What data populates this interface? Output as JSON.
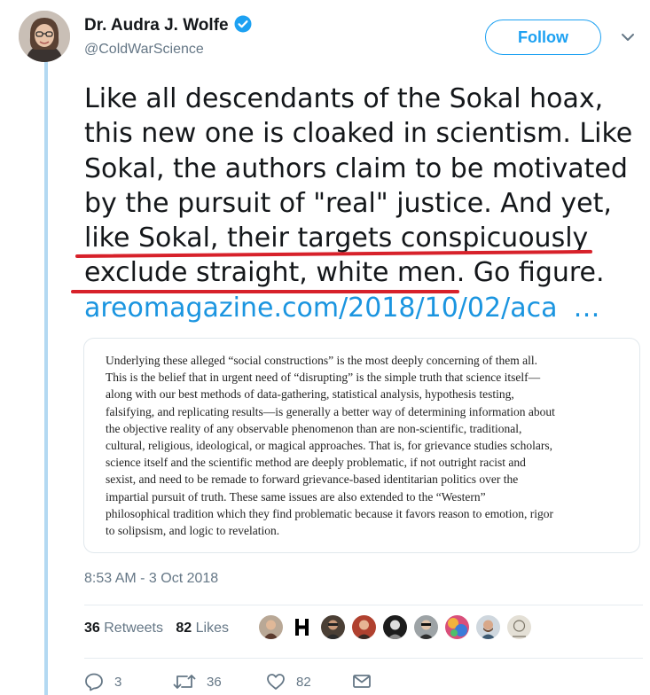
{
  "header": {
    "name": "Dr. Audra J. Wolfe",
    "handle": "@ColdWarScience",
    "follow_label": "Follow"
  },
  "tweet": {
    "lines": [
      "Like all descendants of the Sokal hoax,",
      "this new one is cloaked in scientism. Like",
      "Sokal, the authors claim to be motivated",
      "by the pursuit of \"real\" justice. And yet,",
      "like Sokal, their targets conspicuously",
      "exclude straight, white men. Go figure."
    ],
    "link_text": "areomagazine.com/2018/10/02/aca",
    "link_ellipsis": "…",
    "annotation_color": "#d7212a"
  },
  "card": {
    "quote_lines": [
      "Underlying these alleged “social constructions” is the most deeply concerning of them all.",
      "This is the belief that in urgent need of “disrupting” is the simple truth that science itself—",
      "along with our best methods of data-gathering, statistical analysis, hypothesis testing,",
      "falsifying, and replicating results—is generally a better way of determining information about",
      "the objective reality of any observable phenomenon than are non-scientific, traditional,",
      "cultural, religious, ideological, or magical approaches. That is, for grievance studies scholars,",
      "science itself and the scientific method are deeply problematic, if not outright racist and",
      "sexist, and need to be remade to forward grievance-based identitarian politics over the",
      "impartial pursuit of truth. These same issues are also extended to the “Western”",
      "philosophical tradition which they find problematic because it favors reason to emotion, rigor",
      "to solipsism, and logic to revelation."
    ]
  },
  "meta": {
    "timestamp": "8:53 AM - 3 Oct 2018",
    "retweets_count": "36",
    "retweets_label": "Retweets",
    "likes_count": "82",
    "likes_label": "Likes"
  },
  "actions": {
    "reply_count": "3",
    "retweet_count": "36",
    "like_count": "82"
  },
  "colors": {
    "accent": "#1da1f2",
    "link": "#1b95e0",
    "muted": "#657786",
    "thread_line": "#b3d9f2"
  }
}
